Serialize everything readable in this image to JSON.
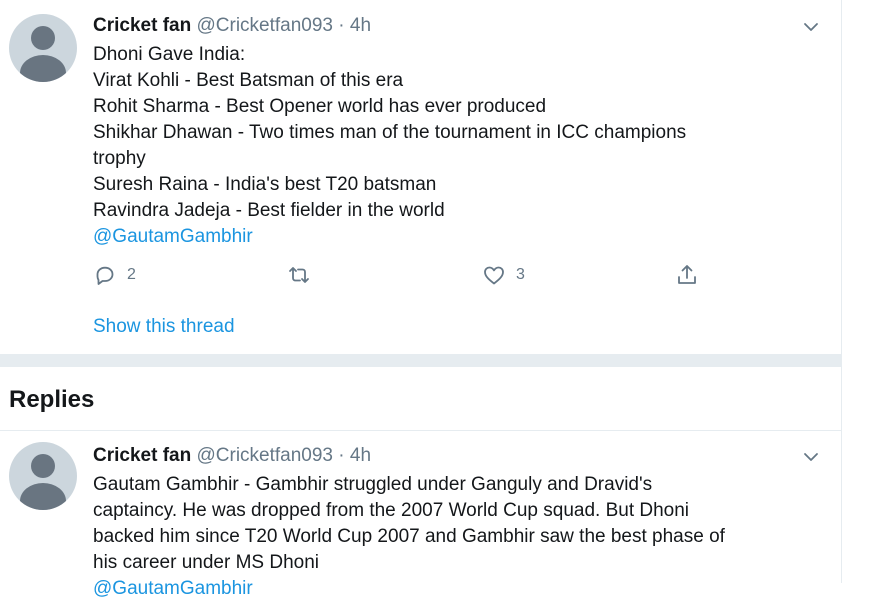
{
  "tweet": {
    "name": "Cricket fan",
    "handle": "@Cricketfan093",
    "time": "· 4h",
    "lines": [
      "Dhoni Gave India:",
      "Virat Kohli - Best Batsman of this era",
      "Rohit Sharma - Best Opener world has ever produced",
      "Shikhar Dhawan - Two times man of the tournament in ICC champions",
      "trophy",
      "Suresh Raina - India's best T20 batsman",
      "Ravindra Jadeja - Best fielder in the world"
    ],
    "mention": "@GautamGambhir",
    "reply_count": "2",
    "like_count": "3",
    "show_thread": "Show this thread"
  },
  "replies_title": "Replies",
  "reply": {
    "name": "Cricket fan",
    "handle": "@Cricketfan093",
    "time": "· 4h",
    "lines": [
      "Gautam Gambhir - Gambhir struggled under Ganguly and Dravid's",
      "captaincy. He was dropped from the 2007 World Cup squad. But Dhoni",
      "backed him since T20 World Cup 2007 and Gambhir saw the best phase of",
      "his career under MS Dhoni"
    ],
    "mention": "@GautamGambhir"
  },
  "colors": {
    "accent": "#1b95e0",
    "muted": "#657786",
    "separator": "#e6ecf0"
  }
}
